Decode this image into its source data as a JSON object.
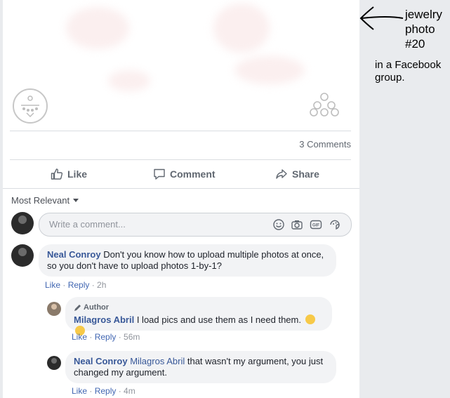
{
  "post": {
    "comments_count": "3 Comments"
  },
  "actions": {
    "like": "Like",
    "comment": "Comment",
    "share": "Share"
  },
  "sort": {
    "label": "Most Relevant"
  },
  "composer": {
    "placeholder": "Write a comment..."
  },
  "comments": [
    {
      "name": "Neal Conroy",
      "text": "Don't you know how to upload multiple photos at once, so you don't have to upload photos 1-by-1?",
      "like": "Like",
      "reply": "Reply",
      "time": "2h"
    }
  ],
  "replies": [
    {
      "author_tag": "Author",
      "name": "Milagros Abril",
      "text": "I load pics and use them as I need them.",
      "like": "Like",
      "reply": "Reply",
      "time": "56m"
    },
    {
      "name": "Neal Conroy",
      "mention": "Milagros Abril",
      "text": "that wasn't my argument, you just changed my argument.",
      "like": "Like",
      "reply": "Reply",
      "time": "4m"
    }
  ],
  "annotation": {
    "line1": "jewelry",
    "line2": "photo",
    "line3": "#20",
    "line4": "in a Facebook",
    "line5": "group."
  },
  "colors": {
    "link": "#385898",
    "bubble": "#f2f3f5",
    "page_bg": "#e9ebee"
  }
}
